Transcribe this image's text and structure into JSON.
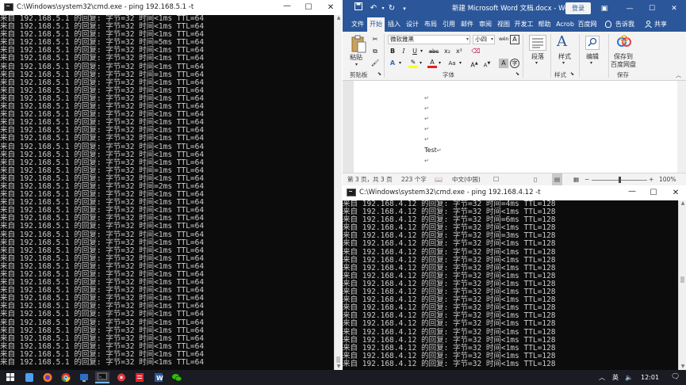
{
  "cmd1": {
    "title": "C:\\Windows\\system32\\cmd.exe - ping  192.168.5.1 -t",
    "lines": [
      "来自 192.168.5.1 的回复: 字节=32 时间<1ms TTL=64",
      "来自 192.168.5.1 的回复: 字节=32 时间<1ms TTL=64",
      "来自 192.168.5.1 的回复: 字节=32 时间<1ms TTL=64",
      "来自 192.168.5.1 的回复: 字节=32 时间=5ms TTL=64",
      "来自 192.168.5.1 的回复: 字节=32 时间<1ms TTL=64",
      "来自 192.168.5.1 的回复: 字节=32 时间<1ms TTL=64",
      "来自 192.168.5.1 的回复: 字节=32 时间<1ms TTL=64",
      "来自 192.168.5.1 的回复: 字节=32 时间=1ms TTL=64",
      "来自 192.168.5.1 的回复: 字节=32 时间<1ms TTL=64",
      "来自 192.168.5.1 的回复: 字节=32 时间<1ms TTL=64",
      "来自 192.168.5.1 的回复: 字节=32 时间<1ms TTL=64",
      "来自 192.168.5.1 的回复: 字节=32 时间<1ms TTL=64",
      "来自 192.168.5.1 的回复: 字节=32 时间<1ms TTL=64",
      "来自 192.168.5.1 的回复: 字节=32 时间<1ms TTL=64",
      "来自 192.168.5.1 的回复: 字节=32 时间<1ms TTL=64",
      "来自 192.168.5.1 的回复: 字节=32 时间<1ms TTL=64",
      "来自 192.168.5.1 的回复: 字节=32 时间<1ms TTL=64",
      "来自 192.168.5.1 的回复: 字节=32 时间<1ms TTL=64",
      "来自 192.168.5.1 的回复: 字节=32 时间<1ms TTL=64",
      "来自 192.168.5.1 的回复: 字节=32 时间=1ms TTL=64",
      "来自 192.168.5.1 的回复: 字节=32 时间<1ms TTL=64",
      "来自 192.168.5.1 的回复: 字节=32 时间=2ms TTL=64",
      "来自 192.168.5.1 的回复: 字节=32 时间<1ms TTL=64",
      "来自 192.168.5.1 的回复: 字节=32 时间<1ms TTL=64",
      "来自 192.168.5.1 的回复: 字节=32 时间<1ms TTL=64",
      "来自 192.168.5.1 的回复: 字节=32 时间<1ms TTL=64",
      "来自 192.168.5.1 的回复: 字节=32 时间<1ms TTL=64",
      "来自 192.168.5.1 的回复: 字节=32 时间<1ms TTL=64",
      "来自 192.168.5.1 的回复: 字节=32 时间<1ms TTL=64",
      "来自 192.168.5.1 的回复: 字节=32 时间<1ms TTL=64",
      "来自 192.168.5.1 的回复: 字节=32 时间<1ms TTL=64",
      "来自 192.168.5.1 的回复: 字节=32 时间<1ms TTL=64",
      "来自 192.168.5.1 的回复: 字节=32 时间<1ms TTL=64",
      "来自 192.168.5.1 的回复: 字节=32 时间<1ms TTL=64",
      "来自 192.168.5.1 的回复: 字节=32 时间<1ms TTL=64",
      "来自 192.168.5.1 的回复: 字节=32 时间<1ms TTL=64",
      "来自 192.168.5.1 的回复: 字节=32 时间<1ms TTL=64",
      "来自 192.168.5.1 的回复: 字节=32 时间<1ms TTL=64",
      "来自 192.168.5.1 的回复: 字节=32 时间<1ms TTL=64",
      "来自 192.168.5.1 的回复: 字节=32 时间<1ms TTL=64",
      "来自 192.168.5.1 的回复: 字节=32 时间<1ms TTL=64",
      "来自 192.168.5.1 的回复: 字节=32 时间<1ms TTL=64",
      "来自 192.168.5.1 的回复: 字节=32 时间<1ms TTL=64",
      "来自 192.168.5.1 的回复: 字节=32 时间<1ms TTL=64"
    ]
  },
  "cmd2": {
    "title": "C:\\Windows\\system32\\cmd.exe - ping  192.168.4.12 -t",
    "lines": [
      "来自 192.168.4.12 的回复: 字节=32 时间=4ms TTL=128",
      "来自 192.168.4.12 的回复: 字节=32 时间<1ms TTL=128",
      "来自 192.168.4.12 的回复: 字节=32 时间=6ms TTL=128",
      "来自 192.168.4.12 的回复: 字节=32 时间<1ms TTL=128",
      "来自 192.168.4.12 的回复: 字节=32 时间=3ms TTL=128",
      "来自 192.168.4.12 的回复: 字节=32 时间<1ms TTL=128",
      "来自 192.168.4.12 的回复: 字节=32 时间<1ms TTL=128",
      "来自 192.168.4.12 的回复: 字节=32 时间<1ms TTL=128",
      "来自 192.168.4.12 的回复: 字节=32 时间<1ms TTL=128",
      "来自 192.168.4.12 的回复: 字节=32 时间<1ms TTL=128",
      "来自 192.168.4.12 的回复: 字节=32 时间<1ms TTL=128",
      "来自 192.168.4.12 的回复: 字节=32 时间<1ms TTL=128",
      "来自 192.168.4.12 的回复: 字节=32 时间<1ms TTL=128",
      "来自 192.168.4.12 的回复: 字节=32 时间<1ms TTL=128",
      "来自 192.168.4.12 的回复: 字节=32 时间<1ms TTL=128",
      "来自 192.168.4.12 的回复: 字节=32 时间<1ms TTL=128",
      "来自 192.168.4.12 的回复: 字节=32 时间<1ms TTL=128",
      "来自 192.168.4.12 的回复: 字节=32 时间<1ms TTL=128",
      "来自 192.168.4.12 的回复: 字节=32 时间<1ms TTL=128",
      "来自 192.168.4.12 的回复: 字节=32 时间<1ms TTL=128",
      "来自 192.168.4.12 的回复: 字节=32 时间<1ms TTL=128"
    ]
  },
  "word": {
    "doc_title": "新建 Microsoft Word 文档.docx  -  Word",
    "login_label": "登录",
    "tabs": [
      "文件",
      "开始",
      "插入",
      "设计",
      "布局",
      "引用",
      "邮件",
      "审阅",
      "视图",
      "开发工",
      "帮助",
      "Acrob",
      "百度网"
    ],
    "active_tab": "开始",
    "tell_me": "告诉我",
    "share": "共享",
    "font_name": "微软雅黑",
    "font_size": "小四",
    "paste_label": "粘贴",
    "groups": [
      "剪贴板",
      "字体",
      "段落",
      "样式",
      "编辑",
      "保存"
    ],
    "style_label": "样式",
    "edit_label": "编辑",
    "save_btn_line1": "保存到",
    "save_btn_line2": "百度网盘",
    "doc_text": "Test",
    "para_mark": "↵",
    "status": {
      "page": "第 3 页，共 3 页",
      "words": "223 个字",
      "lang": "中文(中国)",
      "zoom": "100%"
    },
    "font_btns": {
      "bold": "B",
      "italic": "I",
      "underline": "U",
      "strike": "abc",
      "sub": "x₂",
      "sup": "x²"
    }
  },
  "taskbar": {
    "clock": "12:01",
    "ime": "英"
  },
  "colors": {
    "word_blue": "#2b579a",
    "console_bg": "#0c0c0c",
    "console_fg": "#cccccc"
  }
}
